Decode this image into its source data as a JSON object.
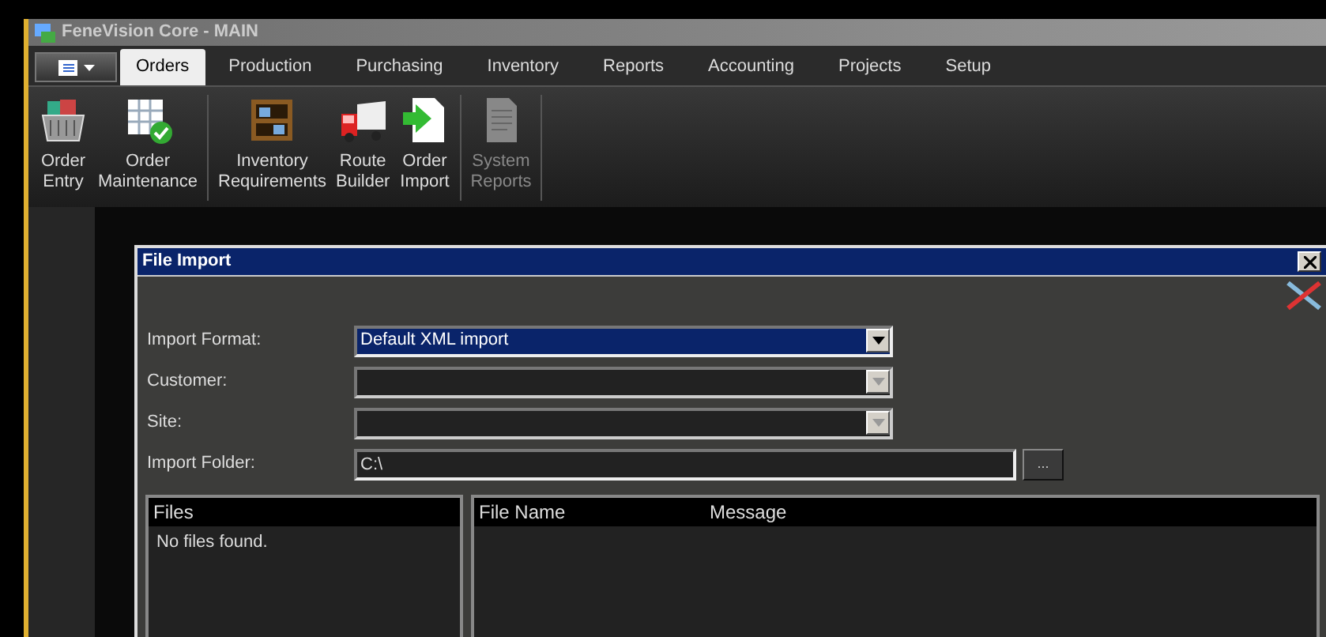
{
  "window": {
    "title": "FeneVision Core - MAIN"
  },
  "tabs": [
    {
      "label": "Orders",
      "selected": true
    },
    {
      "label": "Production",
      "selected": false
    },
    {
      "label": "Purchasing",
      "selected": false
    },
    {
      "label": "Inventory",
      "selected": false
    },
    {
      "label": "Reports",
      "selected": false
    },
    {
      "label": "Accounting",
      "selected": false
    },
    {
      "label": "Projects",
      "selected": false
    },
    {
      "label": "Setup",
      "selected": false
    }
  ],
  "ribbon": {
    "groups": [
      {
        "items": [
          {
            "kind": "basket",
            "label": "Order\nEntry",
            "disabled": false
          },
          {
            "kind": "grid",
            "label": "Order\nMaintenance",
            "disabled": false
          }
        ]
      },
      {
        "items": [
          {
            "kind": "shelf",
            "label": "Inventory\nRequirements",
            "disabled": false
          },
          {
            "kind": "truck",
            "label": "Route\nBuilder",
            "disabled": false
          },
          {
            "kind": "import",
            "label": "Order\nImport",
            "disabled": false
          }
        ]
      },
      {
        "items": [
          {
            "kind": "document",
            "label": "System\nReports",
            "disabled": true
          }
        ]
      }
    ]
  },
  "dialog": {
    "title": "File Import",
    "fields": [
      {
        "kind": "dropdown",
        "label": "Import Format:",
        "value": "Default XML import",
        "selected": true,
        "disabled": false
      },
      {
        "kind": "dropdown",
        "label": "Customer:",
        "selected": false,
        "disabled": true
      },
      {
        "kind": "dropdown",
        "label": "Site:",
        "selected": false,
        "disabled": true
      },
      {
        "kind": "folder",
        "label": "Import Folder:",
        "value": "C:\\",
        "button": "..."
      }
    ],
    "files": {
      "header": "Files",
      "items": [
        "No files found."
      ]
    },
    "results": {
      "columns": [
        "File Name",
        "Message"
      ]
    }
  }
}
